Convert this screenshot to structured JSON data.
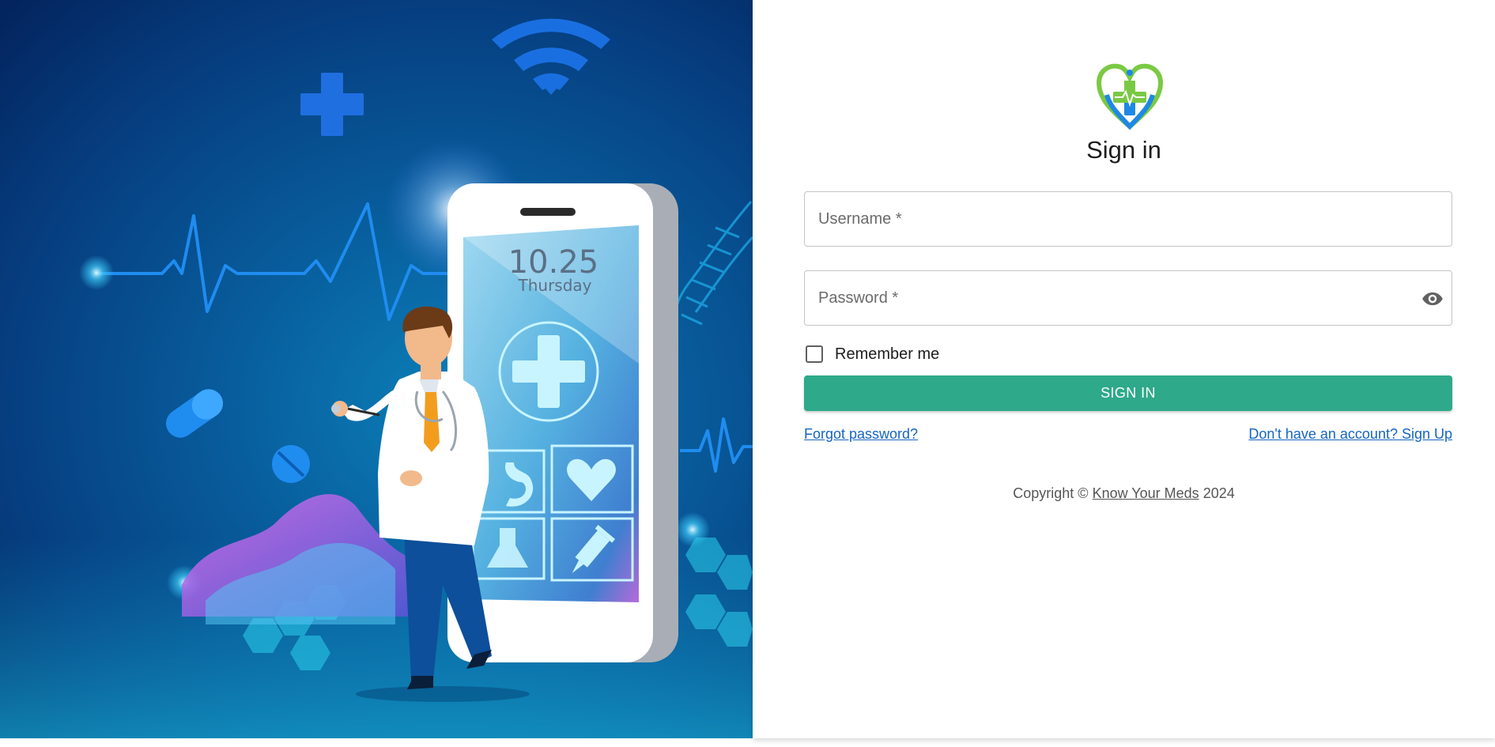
{
  "colors": {
    "accent": "#2ea98a",
    "link": "#1565c0",
    "logo_green": "#7ac943",
    "logo_blue": "#1e88e5"
  },
  "hero": {
    "phone_time": "10.25",
    "phone_day": "Thursday",
    "icons": [
      "medical-cross-icon",
      "wifi-icon",
      "stomach-icon",
      "heart-icon",
      "flask-icon",
      "syringe-icon",
      "pill-icon",
      "doctor-illustration"
    ]
  },
  "login": {
    "logo_icon": "heart-cross-logo-icon",
    "title": "Sign in",
    "username": {
      "placeholder": "Username *",
      "value": ""
    },
    "password": {
      "placeholder": "Password *",
      "value": "",
      "toggle_icon": "eye-icon"
    },
    "remember_label": "Remember me",
    "remember_checked": false,
    "submit_label": "SIGN IN",
    "forgot_link": "Forgot password?",
    "signup_link": "Don't have an account? Sign Up",
    "copyright": {
      "prefix": "Copyright ©",
      "brand": "Know Your Meds",
      "year": "2024"
    }
  }
}
